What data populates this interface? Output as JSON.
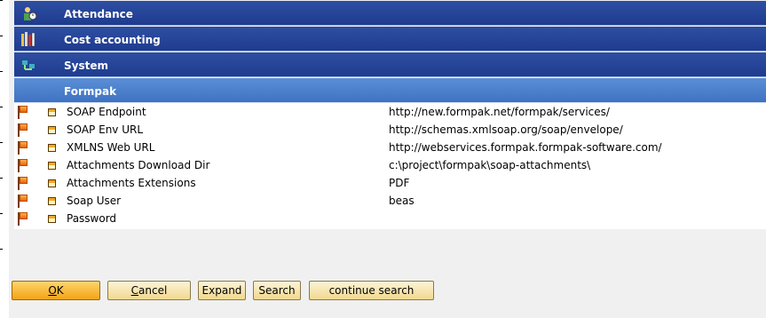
{
  "groups": [
    {
      "label": "Attendance",
      "icon": "person-clock-icon"
    },
    {
      "label": "Cost accounting",
      "icon": "books-icon"
    },
    {
      "label": "System",
      "icon": "network-icon"
    },
    {
      "label": "Formpak",
      "icon": ""
    }
  ],
  "rows": [
    {
      "label": "SOAP Endpoint",
      "value": "http://new.formpak.net/formpak/services/"
    },
    {
      "label": "SOAP Env URL",
      "value": "http://schemas.xmlsoap.org/soap/envelope/"
    },
    {
      "label": "XMLNS Web URL",
      "value": "http://webservices.formpak.formpak-software.com/"
    },
    {
      "label": "Attachments Download Dir",
      "value": "c:\\project\\formpak\\soap-attachments\\"
    },
    {
      "label": "Attachments Extensions",
      "value": "PDF"
    },
    {
      "label": "Soap User",
      "value": "beas"
    },
    {
      "label": "Password",
      "value": ""
    }
  ],
  "buttons": {
    "ok_first": "O",
    "ok_rest": "K",
    "cancel_first": "C",
    "cancel_rest": "ancel",
    "expand": "Expand",
    "search": "Search",
    "continue_search": "continue search"
  },
  "colors": {
    "group_header": "#1f3b8e",
    "active_header": "#3f72c2",
    "button": "#f1d88e",
    "primary_button": "#f2a318",
    "flag": "#e8640a"
  }
}
